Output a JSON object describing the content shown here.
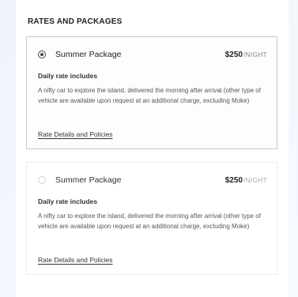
{
  "section": {
    "title": "RATES AND PACKAGES"
  },
  "packages": [
    {
      "selected": true,
      "name": "Summer Package",
      "price": "$250",
      "unit": "/NIGHT",
      "rate_label": "Daily rate includes",
      "description": "A nifty car to explore the island, delivered the morning after arrival (other type of vehicle are available upon request at an additional charge, excluding Moke)",
      "link": "Rate Details and Policies"
    },
    {
      "selected": false,
      "name": "Summer Package",
      "price": "$250",
      "unit": "/NIGHT",
      "rate_label": "Daily rate includes",
      "description": "A nifty car to explore the island, delivered the morning after arrival (other type of vehicle are available upon request at an additional charge, excluding Moke)",
      "link": "Rate Details and Policies"
    }
  ]
}
